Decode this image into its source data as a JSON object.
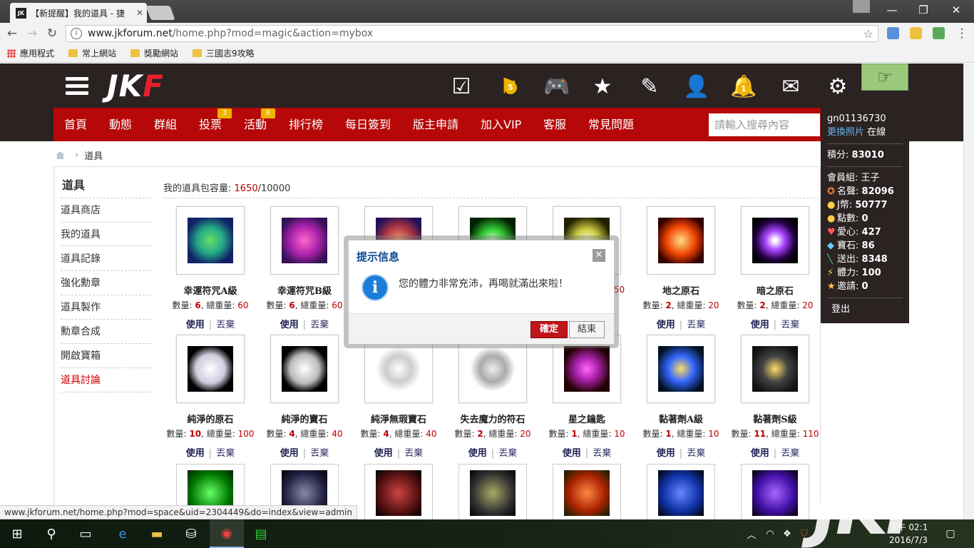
{
  "browser": {
    "tab_title": "【新提醒】我的道具 - 捷",
    "tab_favicon": "JK",
    "url_host": "www.jkforum.net",
    "url_path": "/home.php?mod=magic&action=mybox",
    "bookmarks": [
      "應用程式",
      "常上網站",
      "獎勵網站",
      "三國志9攻略"
    ],
    "status_url": "www.jkforum.net/home.php?mod=space&uid=2304449&do=index&view=admin"
  },
  "header": {
    "logo_main": "JK",
    "logo_accent": "F",
    "flag_badge": "5",
    "bell_badge": "1",
    "icons": [
      "checklist-icon",
      "flag-icon",
      "gamepad-icon",
      "star-icon",
      "edit-icon",
      "add-friend-icon",
      "bell-icon",
      "mail-icon",
      "gear-icon"
    ]
  },
  "nav": {
    "items": [
      "首頁",
      "動態",
      "群組",
      "投票",
      "活動",
      "排行榜",
      "每日簽到",
      "版主申請",
      "加入VIP",
      "客服",
      "常見問題"
    ],
    "vote_badge": "3",
    "event_badge": "6",
    "search_placeholder": "請輸入搜尋內容"
  },
  "breadcrumb": {
    "current": "道具"
  },
  "sidebar": {
    "title": "道具",
    "items": [
      "道具商店",
      "我的道具",
      "道具記錄",
      "強化勳章",
      "道具製作",
      "勳章合成",
      "開啟寶箱",
      "道具討論"
    ]
  },
  "content": {
    "capacity_label": "我的道具包容量:",
    "capacity_used": "1650",
    "capacity_total": "/10000",
    "qty_label": "數量:",
    "weight_label": ", 總重量:",
    "use_label": "使用",
    "drop_label": "丟棄",
    "row1": [
      {
        "name": "幸運符咒A級",
        "qty": "6",
        "weight": "60"
      },
      {
        "name": "幸運符咒B級",
        "qty": "6",
        "weight": "60"
      },
      {
        "name": "",
        "qty": "",
        "weight": ""
      },
      {
        "name": "",
        "qty": "",
        "weight": ""
      },
      {
        "name": "",
        "qty": "",
        "weight": "150"
      },
      {
        "name": "地之原石",
        "qty": "2",
        "weight": "20"
      },
      {
        "name": "暗之原石",
        "qty": "2",
        "weight": "20"
      }
    ],
    "row2": [
      {
        "name": "純淨的原石",
        "qty": "10",
        "weight": "100"
      },
      {
        "name": "純淨的寶石",
        "qty": "4",
        "weight": "40"
      },
      {
        "name": "純淨無瑕寶石",
        "qty": "4",
        "weight": "40"
      },
      {
        "name": "失去魔力的符石",
        "qty": "2",
        "weight": "20"
      },
      {
        "name": "星之鑰匙",
        "qty": "1",
        "weight": "10"
      },
      {
        "name": "黏著劑A級",
        "qty": "1",
        "weight": "10"
      },
      {
        "name": "黏著劑S級",
        "qty": "11",
        "weight": "110"
      }
    ]
  },
  "user_panel": {
    "username": "gn01136730",
    "change_photo": "更換照片",
    "online": "在線",
    "points_label": "積分:",
    "points": "83010",
    "group_label": "會員組:",
    "group": "王子",
    "stats": [
      {
        "label": "名聲:",
        "value": "82096"
      },
      {
        "label": "J幣:",
        "value": "50777"
      },
      {
        "label": "點數:",
        "value": "0"
      },
      {
        "label": "愛心:",
        "value": "427"
      },
      {
        "label": "寶石:",
        "value": "86"
      },
      {
        "label": "送出:",
        "value": "8348"
      },
      {
        "label": "體力:",
        "value": "100"
      },
      {
        "label": "邀請:",
        "value": "0"
      }
    ],
    "logout": "登出"
  },
  "dialog": {
    "title": "提示信息",
    "message": "您的體力非常充沛，再喝就滿出來啦！",
    "ok": "確定",
    "end": "結束",
    "info_glyph": "i"
  },
  "taskbar": {
    "time": "下午 02:1",
    "date": "2016/7/3"
  },
  "colors": {
    "nav_red": "#b60808",
    "header_dark": "#2b2222",
    "badge_gold": "#f0b400",
    "ok_red": "#c0151b"
  }
}
